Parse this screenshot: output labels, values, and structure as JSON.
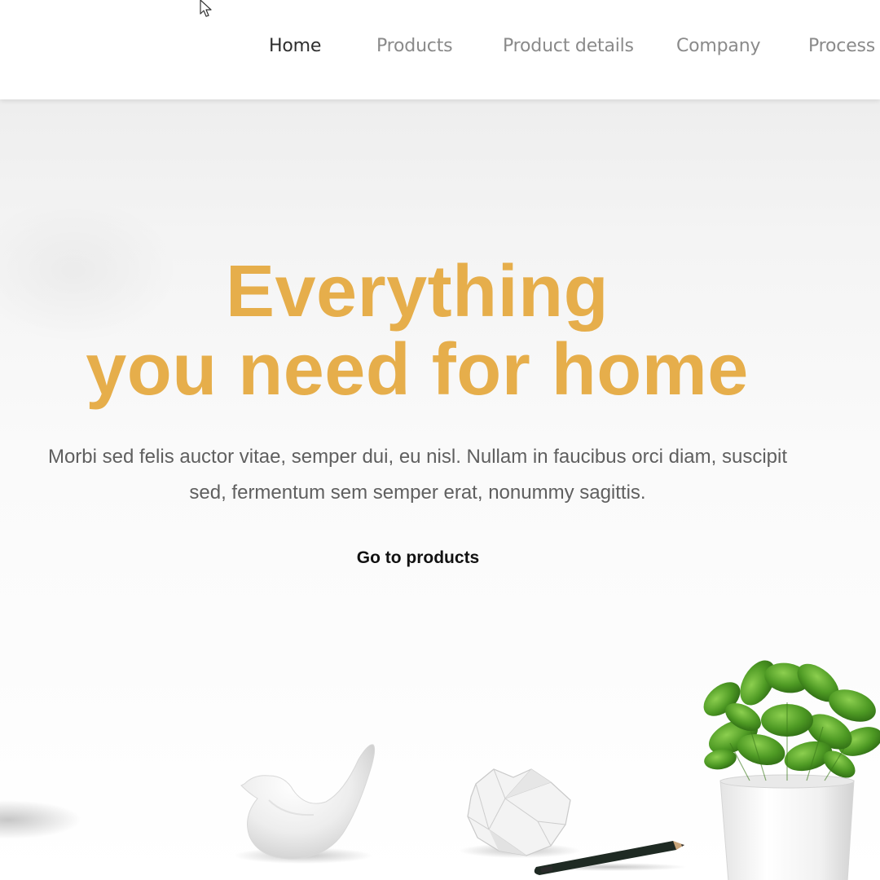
{
  "nav": {
    "items": [
      {
        "label": "Home",
        "active": true
      },
      {
        "label": "Products",
        "active": false
      },
      {
        "label": "Product details",
        "active": false
      },
      {
        "label": "Company",
        "active": false
      },
      {
        "label": "Process",
        "active": false
      }
    ]
  },
  "hero": {
    "headline_line1": "Everything",
    "headline_line2": "you need for home",
    "subtext_line1": "Morbi sed felis auctor vitae, semper dui, eu nisl. Nullam in faucibus orci diam, suscipit",
    "subtext_line2": "sed, fermentum sem semper erat, nonummy sagittis.",
    "cta_label": "Go to products"
  },
  "colors": {
    "accent": "#e6ae4b",
    "nav_active": "#2e2e2e",
    "nav_inactive": "#8a8a8a",
    "body_text": "#5f5f5f"
  },
  "icons": {
    "cursor": "mouse-pointer-icon"
  }
}
